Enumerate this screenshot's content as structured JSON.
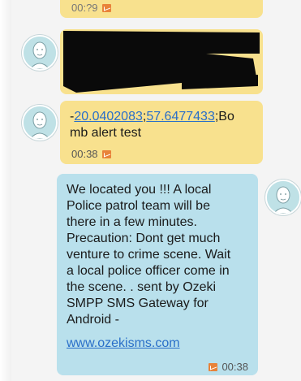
{
  "messages": [
    {
      "direction": "incoming",
      "partial_time": "00:?9"
    },
    {
      "direction": "incoming",
      "redacted": true
    },
    {
      "direction": "incoming",
      "coord_lat": "20.0402083",
      "coord_lon": "57.6477433",
      "prefix": "-",
      "separator": ";",
      "text_after": ";Bo\nmb alert test",
      "time": "00:38"
    },
    {
      "direction": "outgoing",
      "body": "We located you !!! A local\nPolice patrol team will be\nthere in a few minutes.\nPrecaution: Dont get much\nventure to crime scene. Wait\na local police officer come in\nthe scene. . sent by Ozeki\nSMPP SMS Gateway for\nAndroid -",
      "link": "www.ozekisms.com",
      "time": "00:38"
    }
  ],
  "colors": {
    "incoming_bubble": "#f8e18e",
    "outgoing_bubble": "#b9e0ec",
    "link": "#2a6fc9",
    "sms_icon": "#e8833a"
  },
  "icons": {
    "avatar": "person-avatar-icon",
    "sms": "sms-message-icon"
  }
}
